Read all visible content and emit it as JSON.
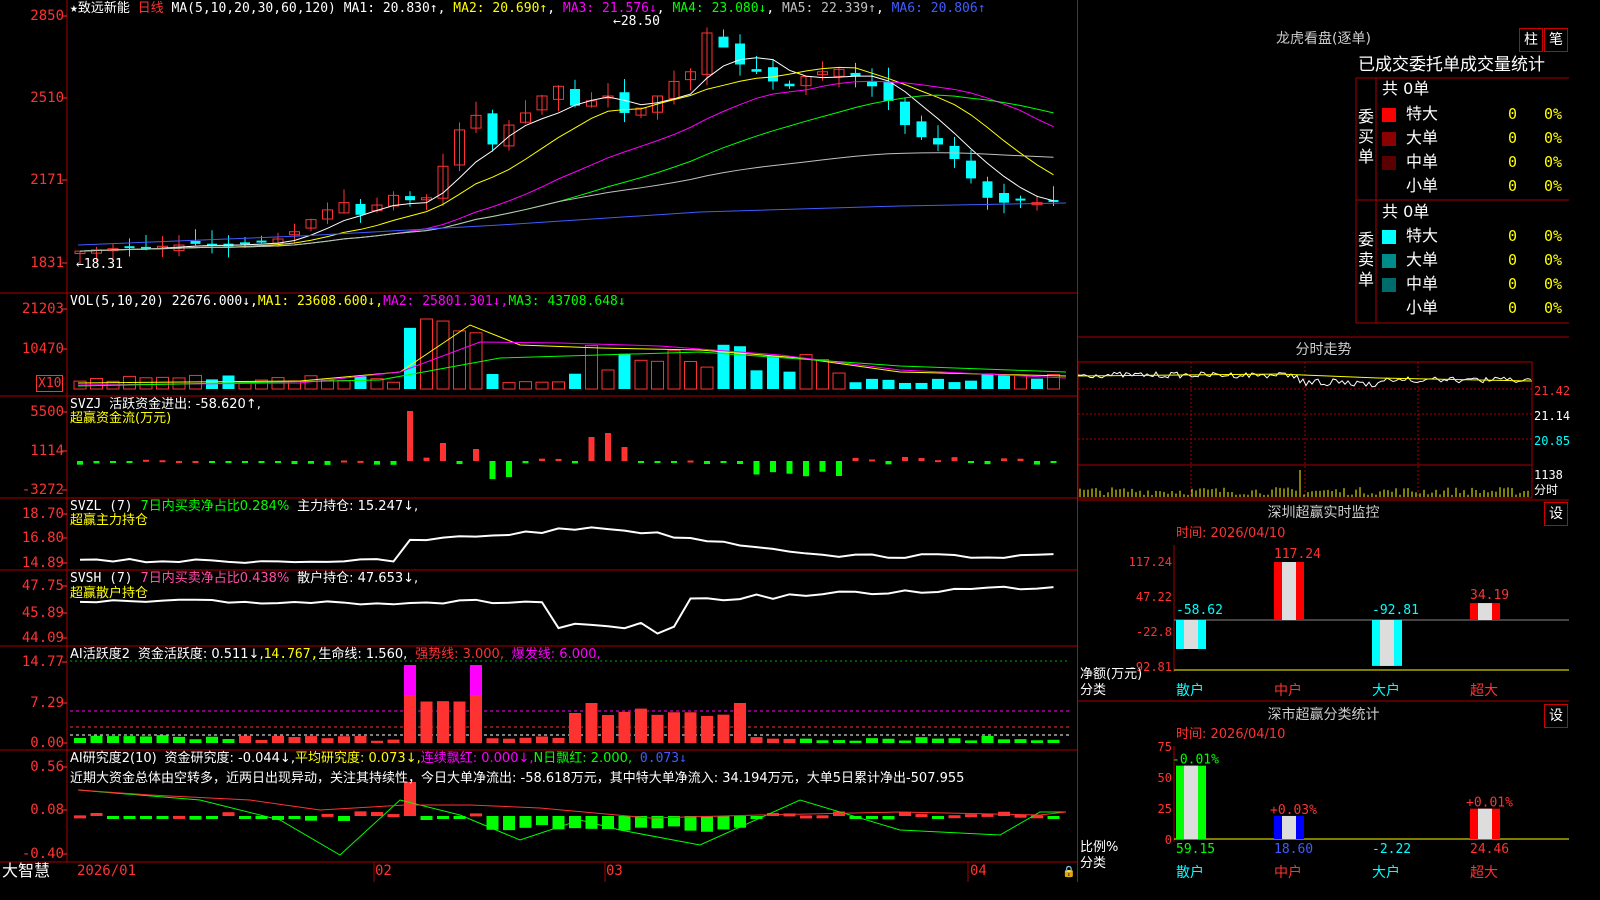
{
  "colors": {
    "up": "#ff3232",
    "down": "#00ffff",
    "ma1": "#ffffff",
    "ma2": "#ffff00",
    "ma3": "#ff00ff",
    "ma4": "#00ff00",
    "ma5": "#c0c0c0",
    "ma6": "#3f5cff",
    "grid": "#aa0000"
  },
  "header": {
    "star": "★",
    "stock": "致远新能",
    "period": "日线",
    "ma_params": "MA(5,10,20,30,60,120)",
    "ma1": "MA1: 20.830↑",
    "ma2": "MA2: 20.690↑",
    "ma3": "MA3: 21.576↓",
    "ma4": "MA4: 23.080↓",
    "ma5": "MA5: 22.339↑",
    "ma6": "MA6: 20.806↑"
  },
  "kline": {
    "axis": [
      "2850",
      "2510",
      "2171",
      "1831"
    ],
    "max_label": "28.50",
    "min_label": "18.31"
  },
  "vol": {
    "title": "VOL(5,10,20)",
    "val": "22676.000↓,",
    "ma1": "MA1: 23608.600↓,",
    "ma2": "MA2: 25801.301↓,",
    "ma3": "MA3: 43708.648↓",
    "axis": [
      "21203",
      "10470"
    ],
    "unit": "X10"
  },
  "svzj": {
    "title": "SVZJ",
    "desc": "活跃资金进出: -58.620↑,",
    "sub": "超赢资金流(万元)",
    "axis": [
      "5500",
      "1114",
      "-3272"
    ]
  },
  "svzl": {
    "title": "SVZL (7)",
    "desc": "7日内买卖净占比0.284%",
    "hold": "主力持仓: 15.247↓,",
    "sub": "超赢主力持仓",
    "axis": [
      "18.70",
      "16.80",
      "14.89"
    ]
  },
  "svsh": {
    "title": "SVSH (7)",
    "desc": "7日内买卖净占比0.438%",
    "hold": "散户持仓: 47.653↓,",
    "sub": "超赢散户持仓",
    "axis": [
      "47.75",
      "45.89",
      "44.09"
    ]
  },
  "ai1": {
    "title": "AI活跃度2",
    "desc": "资金活跃度: 0.511↓,",
    "v2": "14.767,",
    "life": "生命线: 1.560,",
    "strong": "强势线: 3.000,",
    "burst": "爆发线: 6.000,",
    "axis": [
      "14.77",
      "7.29",
      "0.00"
    ]
  },
  "ai2": {
    "title": "AI研究度2(10)",
    "desc": "资金研究度: -0.044↓,",
    "avg": "平均研究度: 0.073↓,",
    "streak": "连续飘红: 0.000↓,",
    "nred": "N日飘红: 2.000,",
    "last": "0.073↓",
    "comment": "近期大资金总体由空转多，近两日出现异动，关注其持续性，今日大单净流出: -58.618万元，其中特大单净流入: 34.194万元，大单5日累计净出-507.955",
    "axis": [
      "0.56",
      "0.08",
      "-0.40"
    ]
  },
  "xaxis": {
    "labels": [
      "2026/01",
      "02",
      "03",
      "04"
    ],
    "logo": "大智慧"
  },
  "lhb": {
    "title": "龙虎看盘(逐单)",
    "btn1": "柱",
    "btn2": "笔",
    "subtitle": "已成交委托单成交量统计",
    "buy_label": "委买单",
    "sell_label": "委卖单",
    "buy_total": "共 0单",
    "sell_total": "共 0单",
    "buy_rows": [
      {
        "name": "特大",
        "qty": "0",
        "pct": "0%",
        "color": "#ff0000"
      },
      {
        "name": "大单",
        "qty": "0",
        "pct": "0%",
        "color": "#8b0000"
      },
      {
        "name": "中单",
        "qty": "0",
        "pct": "0%",
        "color": "#5a0000"
      },
      {
        "name": "小单",
        "qty": "0",
        "pct": "0%",
        "color": "#000000"
      }
    ],
    "sell_rows": [
      {
        "name": "特大",
        "qty": "0",
        "pct": "0%",
        "color": "#00ffff"
      },
      {
        "name": "大单",
        "qty": "0",
        "pct": "0%",
        "color": "#008b8b"
      },
      {
        "name": "中单",
        "qty": "0",
        "pct": "0%",
        "color": "#006b6b"
      },
      {
        "name": "小单",
        "qty": "0",
        "pct": "0%",
        "color": "#000000"
      }
    ]
  },
  "fenshi": {
    "title": "分时走势",
    "axis": [
      "21.42",
      "21.14",
      "20.85",
      "1138"
    ],
    "unit": "分时"
  },
  "sz_monitor": {
    "title": "深圳超赢实时监控",
    "btn": "设",
    "time": "时间: 2026/04/10",
    "axis": [
      "117.24",
      "47.22",
      "-22.8",
      "-92.81"
    ],
    "ylabel": "净额(万元)",
    "xlabel": "分类",
    "bars": [
      {
        "cat": "散户",
        "value": -58.62,
        "label": "-58.62"
      },
      {
        "cat": "中户",
        "value": 117.24,
        "label": "117.24"
      },
      {
        "cat": "大户",
        "value": -92.81,
        "label": "-92.81"
      },
      {
        "cat": "超大",
        "value": 34.19,
        "label": "34.19"
      }
    ]
  },
  "sz_class": {
    "title": "深市超赢分类统计",
    "btn": "设",
    "time": "时间: 2026/04/10",
    "axis": [
      "75",
      "50",
      "25",
      "0"
    ],
    "ylabel": "比例%",
    "xlabel": "分类",
    "bars": [
      {
        "cat": "散户",
        "value": 59.15,
        "label": "59.15",
        "chg": "-0.01%"
      },
      {
        "cat": "中户",
        "value": 18.6,
        "label": "18.60",
        "chg": "+0.03%"
      },
      {
        "cat": "大户",
        "value": -2.22,
        "label": "-2.22",
        "chg": ""
      },
      {
        "cat": "超大",
        "value": 24.46,
        "label": "24.46",
        "chg": "+0.01%"
      }
    ]
  }
}
